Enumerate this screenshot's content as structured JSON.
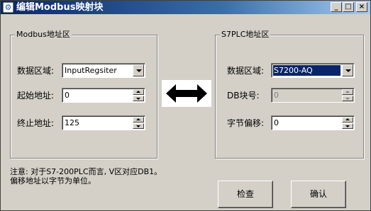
{
  "window": {
    "title": "编辑Modbus映射块",
    "caption_buttons": {
      "minimize": "_",
      "maximize": "□",
      "close": "×"
    }
  },
  "modbus": {
    "group_title": "Modbus地址区",
    "area_label": "数据区域:",
    "area_value": "InputRegsiter",
    "start_label": "起始地址:",
    "start_value": "0",
    "end_label": "终止地址:",
    "end_value": "125"
  },
  "s7plc": {
    "group_title": "S7PLC地址区",
    "area_label": "数据区域:",
    "area_value": "S7200-AQ",
    "db_label": "DB块号:",
    "db_value": "0",
    "offset_label": "字节偏移:",
    "offset_value": "0"
  },
  "notes": {
    "line1": "注意: 对于S7-200PLC而言, V区对应DB1。",
    "line2": "偏移地址以字节为单位。"
  },
  "buttons": {
    "check": "检查",
    "confirm": "确认"
  },
  "icons": {
    "app": "gear-icon",
    "arrow": "bidirectional-arrow-icon"
  },
  "colors": {
    "titlebar_start": "#0a246a",
    "titlebar_end": "#a6caf0",
    "selection": "#0a246a",
    "face": "#d4d0c8"
  }
}
